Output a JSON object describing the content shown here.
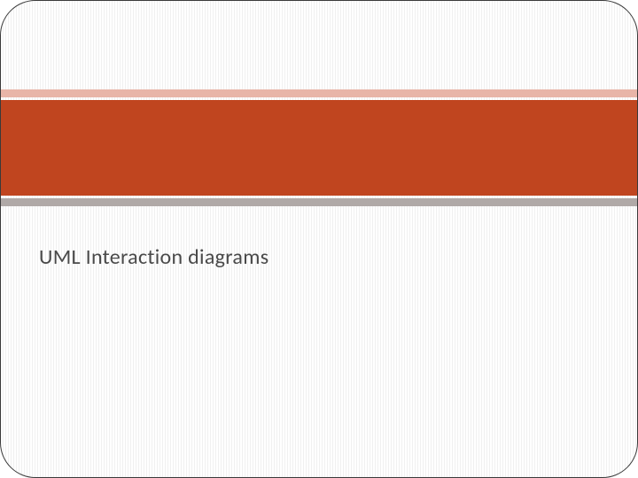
{
  "slide": {
    "title": "UML Interaction diagrams"
  },
  "colors": {
    "top_accent": "#e8b5a8",
    "main_band": "#c0451f",
    "bottom_accent": "#b0a9a7",
    "text": "#4a4a4a"
  }
}
